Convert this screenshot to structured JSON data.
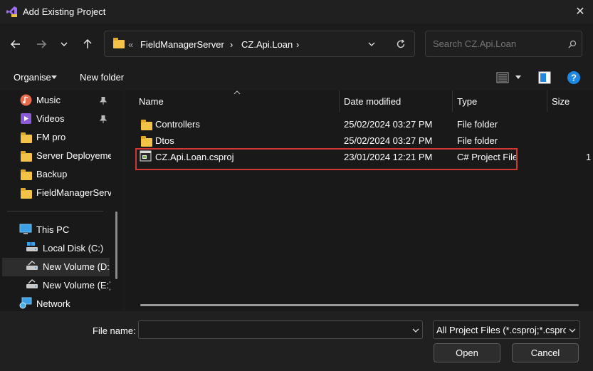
{
  "window": {
    "title": "Add Existing Project",
    "close_glyph": "✕"
  },
  "nav": {
    "breadcrumb_chevron": "«",
    "breadcrumb": [
      "FieldManagerServer",
      "CZ.Api.Loan"
    ],
    "crumb_sep": "›",
    "search_placeholder": "Search CZ.Api.Loan"
  },
  "toolbar": {
    "organise": "Organise",
    "new_folder": "New folder"
  },
  "sidebar": {
    "items": [
      {
        "label": "Music",
        "icon": "music-icon",
        "pinned": true
      },
      {
        "label": "Videos",
        "icon": "videos-icon",
        "pinned": true
      },
      {
        "label": "FM pro",
        "icon": "folder-icon"
      },
      {
        "label": "Server Deployement",
        "icon": "folder-icon"
      },
      {
        "label": "Backup",
        "icon": "folder-icon"
      },
      {
        "label": "FieldManagerServer",
        "icon": "folder-icon"
      }
    ],
    "pc_items": [
      {
        "label": "This PC",
        "icon": "pc-icon"
      },
      {
        "label": "Local Disk (C:)",
        "icon": "disk-icon"
      },
      {
        "label": "New Volume (D:)",
        "icon": "disk-icon",
        "selected": true
      },
      {
        "label": "New Volume (E:)",
        "icon": "disk-icon"
      },
      {
        "label": "Network",
        "icon": "network-icon"
      }
    ]
  },
  "columns": {
    "name": "Name",
    "date": "Date modified",
    "type": "Type",
    "size": "Size"
  },
  "files": [
    {
      "name": "Controllers",
      "date": "25/02/2024 03:27 PM",
      "type": "File folder",
      "size": "",
      "icon": "folder-icon"
    },
    {
      "name": "Dtos",
      "date": "25/02/2024 03:27 PM",
      "type": "File folder",
      "size": "",
      "icon": "folder-icon"
    },
    {
      "name": "CZ.Api.Loan.csproj",
      "date": "23/01/2024 12:21 PM",
      "type": "C# Project File",
      "size": "1",
      "icon": "csproj-icon",
      "highlighted": true
    }
  ],
  "footer": {
    "file_name_label": "File name:",
    "file_name_value": "",
    "filter": "All Project Files (*.csproj;*.csproj",
    "open": "Open",
    "cancel": "Cancel"
  },
  "colors": {
    "highlight": "#d03838",
    "folder": "#f2c346",
    "help": "#1e88e5"
  }
}
